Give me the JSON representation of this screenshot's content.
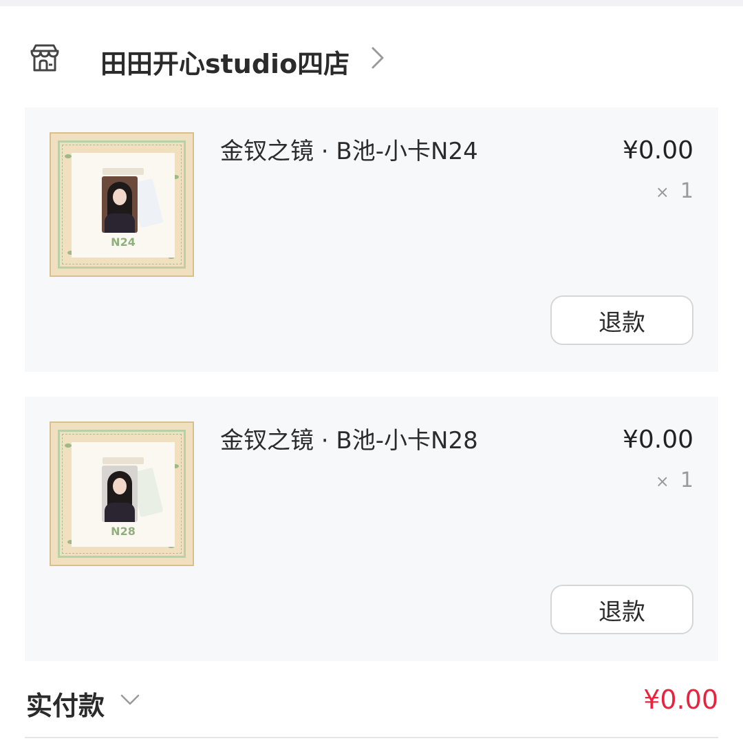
{
  "shop": {
    "name": "田田开心studio四店",
    "icon": "store-icon"
  },
  "items": [
    {
      "title": "金钗之镜 · B池-小卡N24",
      "price": "¥0.00",
      "qty_symbol": "×",
      "qty": "1",
      "card_code": "N24",
      "refund_label": "退款"
    },
    {
      "title": "金钗之镜 · B池-小卡N28",
      "price": "¥0.00",
      "qty_symbol": "×",
      "qty": "1",
      "card_code": "N28",
      "refund_label": "退款"
    }
  ],
  "total": {
    "label": "实付款",
    "amount": "¥0.00"
  },
  "colors": {
    "total_amount": "#e8233f",
    "card_bg": "#f7f8fa"
  }
}
